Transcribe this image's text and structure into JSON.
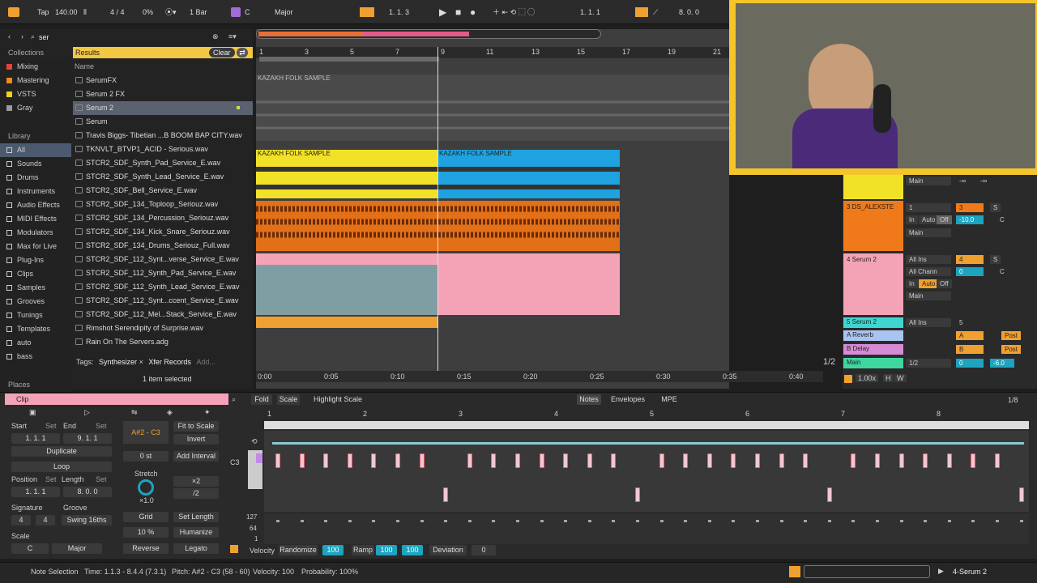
{
  "transport": {
    "tap": "Tap",
    "tempo": "140.00",
    "signature": "4 / 4",
    "groove": "0%",
    "quantize": "1 Bar",
    "key": "C",
    "scale": "Major",
    "position": "1.  1.  3",
    "loop_start": "1.  1.  1",
    "loop_len": "8.  0.  0"
  },
  "browser": {
    "search": "ser",
    "collections_title": "Collections",
    "results_title": "Results",
    "clear_label": "Clear",
    "name_header": "Name",
    "collections": [
      {
        "label": "Mixing",
        "color": "#e8423a"
      },
      {
        "label": "Mastering",
        "color": "#f08a1a"
      },
      {
        "label": "VSTS",
        "color": "#f2d11a"
      },
      {
        "label": "Gray",
        "color": "#9a9a9a"
      }
    ],
    "library_title": "Library",
    "library": [
      "All",
      "Sounds",
      "Drums",
      "Instruments",
      "Audio Effects",
      "MIDI Effects",
      "Modulators",
      "Max for Live",
      "Plug-Ins",
      "Clips",
      "Samples",
      "Grooves",
      "Tunings",
      "Templates",
      "auto",
      "bass"
    ],
    "places_title": "Places",
    "items": [
      "SerumFX",
      "Serum 2 FX",
      "Serum 2",
      "Serum",
      "Travis Biggs- Tibetian ...B BOOM BAP CITY.wav",
      "TKNVLT_BTVP1_ACID - Serious.wav",
      "STCR2_SDF_Synth_Pad_Service_E.wav",
      "STCR2_SDF_Synth_Lead_Service_E.wav",
      "STCR2_SDF_Bell_Service_E.wav",
      "STCR2_SDF_134_Toploop_Seriouz.wav",
      "STCR2_SDF_134_Percussion_Seriouz.wav",
      "STCR2_SDF_134_Kick_Snare_Seriouz.wav",
      "STCR2_SDF_134_Drums_Seriouz_Full.wav",
      "STCR2_SDF_112_Synt...verse_Service_E.wav",
      "STCR2_SDF_112_Synth_Pad_Service_E.wav",
      "STCR2_SDF_112_Synth_Lead_Service_E.wav",
      "STCR2_SDF_112_Synt...ccent_Service_E.wav",
      "STCR2_SDF_112_Mel...Stack_Service_E.wav",
      "Rimshot Serendipity of Surprise.wav",
      "Rain On The Servers.adg"
    ],
    "tags_label": "Tags:",
    "tags": [
      "Synthesizer",
      "Xfer Records"
    ],
    "tags_add": "Add...",
    "selected_count": "1 item selected"
  },
  "arrangement": {
    "bars": [
      "1",
      "3",
      "5",
      "7",
      "9",
      "11",
      "13",
      "15",
      "17",
      "19",
      "21"
    ],
    "times": [
      "0:00",
      "0:05",
      "0:10",
      "0:15",
      "0:20",
      "0:25",
      "0:30",
      "0:35",
      "0:40"
    ],
    "clip_label": "KAZAKH FOLK SAMPLE"
  },
  "mixer": {
    "tracks": [
      {
        "name": "3 DS_ALEXSTE",
        "color": "#f07a1a"
      },
      {
        "name": "4 Serum 2",
        "color": "#f4a3b7"
      },
      {
        "name": "5 Serum 2",
        "color": "#3fd6d0"
      },
      {
        "name": "A Reverb",
        "color": "#a8c4f0"
      },
      {
        "name": "B Delay",
        "color": "#d78ad6"
      },
      {
        "name": "Main",
        "color": "#3fd6a0"
      }
    ],
    "main_label": "Main",
    "all_ins": "All Ins",
    "all_channels": "All Chann",
    "in": "In",
    "auto": "Auto",
    "off": "Off",
    "vol_3": "-10.0",
    "vol_main": "-6.0",
    "send_a": "A",
    "send_b": "B",
    "post": "Post",
    "pager": "1/2",
    "zoom": "1.00x",
    "h": "H",
    "w": "W",
    "n3": "3",
    "n4": "4",
    "n5": "5",
    "zero": "0",
    "s": "S",
    "c": "C",
    "minf": "-∞",
    "half": "1/2",
    "one": "1"
  },
  "clip": {
    "title": "Clip",
    "start_label": "Start",
    "end_label": "End",
    "set_label": "Set",
    "start_val": "1.   1.   1",
    "end_val": "9.   1.   1",
    "duplicate": "Duplicate",
    "loop": "Loop",
    "position_label": "Position",
    "length_label": "Length",
    "position_val": "1.   1.   1",
    "length_val": "8.   0.   0",
    "signature_label": "Signature",
    "groove_label": "Groove",
    "sig_num": "4",
    "sig_den": "4",
    "groove_val": "Swing 16ths",
    "scale_label": "Scale",
    "scale_key": "C",
    "scale_name": "Major",
    "range": "A#2 - C3",
    "fit_scale": "Fit to Scale",
    "invert": "Invert",
    "semitone": "0 st",
    "add_interval": "Add Interval",
    "stretch": "Stretch",
    "stretch_val": "×1.0",
    "x2": "×2",
    "div2": "/2",
    "grid": "Grid",
    "set_length": "Set Length",
    "pct": "10 %",
    "humanize": "Humanize",
    "reverse": "Reverse",
    "legato": "Legato"
  },
  "editor": {
    "fold": "Fold",
    "scale": "Scale",
    "highlight_scale": "Highlight Scale",
    "notes_tab": "Notes",
    "envelopes_tab": "Envelopes",
    "mpe_tab": "MPE",
    "grid_div": "1/8",
    "bars": [
      "1",
      "2",
      "3",
      "4",
      "5",
      "6",
      "7",
      "8"
    ],
    "pitch_label": "C3",
    "vel_top": "127",
    "vel_mid": "64",
    "vel_bot": "1",
    "velocity": "Velocity",
    "randomize": "Randomize",
    "rand_val": "100",
    "ramp": "Ramp",
    "ramp_a": "100",
    "ramp_b": "100",
    "deviation": "Deviation",
    "dev_val": "0"
  },
  "status": {
    "mode": "Note Selection",
    "time": "Time: 1.1.3 - 8.4.4 (7.3.1)",
    "pitch": "Pitch: A#2 - C3 (58 - 60)",
    "velocity": "Velocity: 100",
    "probability": "Probability: 100%",
    "track": "4-Serum 2"
  }
}
